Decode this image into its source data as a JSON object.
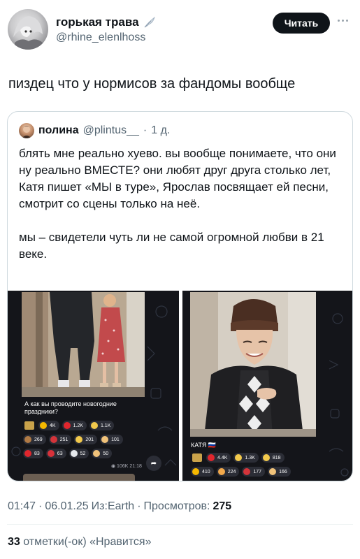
{
  "author": {
    "display_name": "горькая трава",
    "handle": "@rhine_elenlhoss",
    "follow_label": "Читать",
    "verified_icon": "feather-icon",
    "more_icon": "more-dots-icon"
  },
  "tweet": {
    "text": "пиздец что у нормисов за фандомы вообще"
  },
  "quote": {
    "name": "полина",
    "handle": "@plintus__",
    "dot": "·",
    "time": "1 д.",
    "paragraph_1": "блять мне реально хуево. вы вообще понимаете, что они ну реально ВМЕСТЕ? они любят друг друга столько лет, Катя пишет «МЫ в туре», Ярослав посвящает ей песни, смотрит со сцены только на неё.",
    "paragraph_2": "мы – свидетели чуть ли не самой огромной любви в 21 веке.",
    "media_left": {
      "caption": "А как вы проводите новогодние праздники?",
      "reactions_row1": [
        "4K",
        "1.2K",
        "1.1K"
      ],
      "reactions_row2": [
        "269",
        "251",
        "201",
        "101"
      ],
      "reactions_row3": [
        "83",
        "63",
        "52",
        "50"
      ],
      "views": "◉ 106K 21:18"
    },
    "media_right": {
      "caption": "КАТЯ 🇷🇺",
      "reactions_row1": [
        "4.4K",
        "1.3K",
        "818"
      ],
      "reactions_row2": [
        "410",
        "224",
        "177",
        "166"
      ]
    }
  },
  "meta": {
    "time": "01:47",
    "sep1": "·",
    "date": "06.01.25",
    "source": "Из:Earth",
    "sep2": "·",
    "views_label": "Просмотров:",
    "views_count": "275"
  },
  "likes": {
    "count": "33",
    "label": "отметки(-ок) «Нравится»"
  },
  "colors": {
    "text_primary": "#0f1419",
    "text_secondary": "#536471",
    "border": "#cfd9de",
    "button_bg": "#0f1419",
    "media_bg": "#14151a"
  }
}
